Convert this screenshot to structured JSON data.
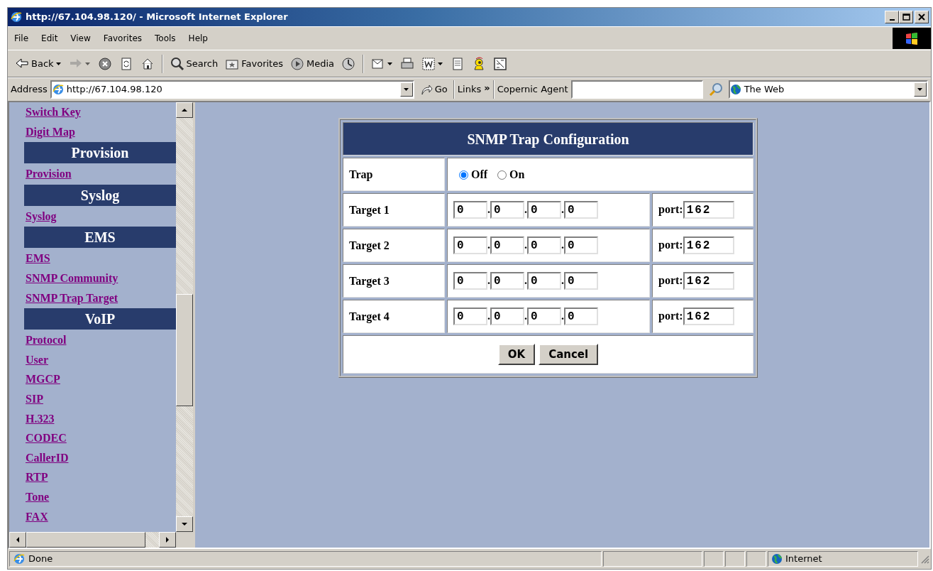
{
  "window": {
    "title": "http://67.104.98.120/ - Microsoft Internet Explorer"
  },
  "menu": [
    "File",
    "Edit",
    "View",
    "Favorites",
    "Tools",
    "Help"
  ],
  "toolbar": [
    {
      "kind": "button",
      "label": "Back",
      "dropdown": true,
      "disabled": false
    },
    {
      "kind": "icon",
      "dropdown": true,
      "disabled": true
    },
    {
      "kind": "icon",
      "dropdown": false,
      "disabled": false
    },
    {
      "kind": "icon",
      "dropdown": false,
      "disabled": false
    },
    {
      "kind": "icon",
      "dropdown": false,
      "disabled": false
    },
    {
      "kind": "separator"
    },
    {
      "kind": "button",
      "label": "Search",
      "dropdown": false,
      "disabled": false
    },
    {
      "kind": "button",
      "label": "Favorites",
      "dropdown": false,
      "disabled": false
    },
    {
      "kind": "button",
      "label": "Media",
      "dropdown": false,
      "disabled": false
    },
    {
      "kind": "icon",
      "dropdown": false,
      "disabled": false
    },
    {
      "kind": "separator"
    },
    {
      "kind": "icon",
      "dropdown": true,
      "disabled": false
    },
    {
      "kind": "icon",
      "dropdown": false,
      "disabled": false
    },
    {
      "kind": "icon",
      "dropdown": true,
      "disabled": false
    },
    {
      "kind": "icon",
      "dropdown": false,
      "disabled": false
    },
    {
      "kind": "icon",
      "dropdown": false,
      "disabled": false
    },
    {
      "kind": "icon",
      "dropdown": false,
      "disabled": false
    }
  ],
  "address_bar": {
    "label": "Address",
    "value": "http://67.104.98.120",
    "go": "Go",
    "links": "Links",
    "links_more": "»",
    "agent_label": "Copernic Agent",
    "search_scope": "The Web"
  },
  "sidebar": [
    {
      "kind": "link",
      "label": "Switch Key"
    },
    {
      "kind": "link",
      "label": "Digit Map"
    },
    {
      "kind": "header",
      "label": "Provision"
    },
    {
      "kind": "link",
      "label": "Provision"
    },
    {
      "kind": "header",
      "label": "Syslog"
    },
    {
      "kind": "link",
      "label": "Syslog"
    },
    {
      "kind": "header",
      "label": "EMS"
    },
    {
      "kind": "link",
      "label": "EMS"
    },
    {
      "kind": "link",
      "label": "SNMP Community"
    },
    {
      "kind": "link",
      "label": "SNMP Trap Target"
    },
    {
      "kind": "header",
      "label": "VoIP"
    },
    {
      "kind": "link",
      "label": "Protocol"
    },
    {
      "kind": "link",
      "label": "User"
    },
    {
      "kind": "link",
      "label": "MGCP"
    },
    {
      "kind": "link",
      "label": "SIP"
    },
    {
      "kind": "link",
      "label": "H.323"
    },
    {
      "kind": "link",
      "label": "CODEC"
    },
    {
      "kind": "link",
      "label": "CallerID"
    },
    {
      "kind": "link",
      "label": "RTP"
    },
    {
      "kind": "link",
      "label": "Tone"
    },
    {
      "kind": "link",
      "label": "FAX"
    }
  ],
  "form": {
    "title": "SNMP Trap Configuration",
    "trap_label": "Trap",
    "trap_options": [
      {
        "label": "Off",
        "selected": true
      },
      {
        "label": "On",
        "selected": false
      }
    ],
    "targets": [
      {
        "label": "Target 1",
        "octets": [
          "0",
          "0",
          "0",
          "0"
        ],
        "port_label": "port:",
        "port": "162"
      },
      {
        "label": "Target 2",
        "octets": [
          "0",
          "0",
          "0",
          "0"
        ],
        "port_label": "port:",
        "port": "162"
      },
      {
        "label": "Target 3",
        "octets": [
          "0",
          "0",
          "0",
          "0"
        ],
        "port_label": "port:",
        "port": "162"
      },
      {
        "label": "Target 4",
        "octets": [
          "0",
          "0",
          "0",
          "0"
        ],
        "port_label": "port:",
        "port": "162"
      }
    ],
    "separator": ".",
    "buttons": [
      "OK",
      "Cancel"
    ]
  },
  "status_bar": {
    "text": "Done",
    "zone": "Internet"
  }
}
